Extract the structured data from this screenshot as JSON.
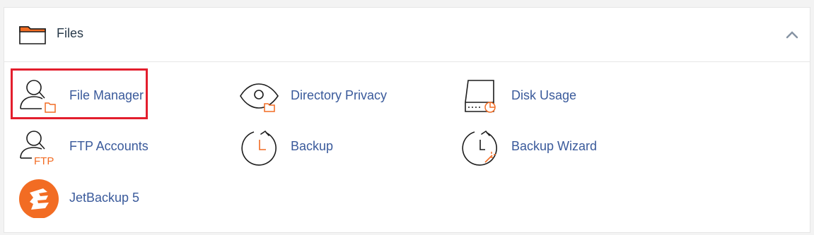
{
  "section": {
    "title": "Files"
  },
  "items": [
    {
      "label": "File Manager"
    },
    {
      "label": "Directory Privacy"
    },
    {
      "label": "Disk Usage"
    },
    {
      "label": "FTP Accounts"
    },
    {
      "label": "Backup"
    },
    {
      "label": "Backup Wizard"
    },
    {
      "label": "JetBackup 5"
    }
  ],
  "icon_text": {
    "ftp": "FTP"
  },
  "colors": {
    "accent": "#f26c23",
    "link": "#3a5a9b",
    "highlight": "#e31e2d",
    "icon_stroke": "#1c1c1c"
  }
}
